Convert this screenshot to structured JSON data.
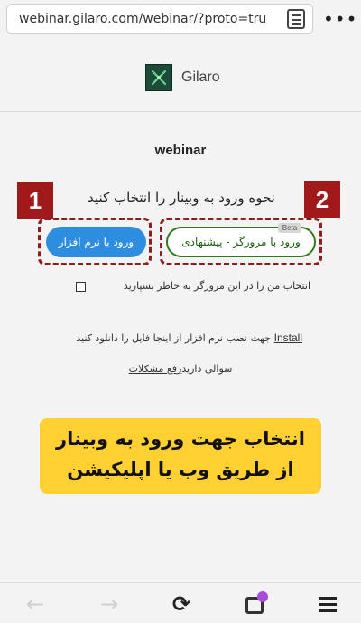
{
  "browser": {
    "url": "webinar.gilaro.com/webinar/?proto=tru",
    "reader_icon": "reader-mode-icon",
    "menu_icon": "more-dots-icon",
    "menu_glyph": "•••"
  },
  "header": {
    "logo_icon": "gilaro-logo-icon",
    "brand": "Gilaro"
  },
  "page": {
    "title": "webinar",
    "question": "نحوه ورود به وبینار را انتخاب کنید",
    "badge_1": "1",
    "badge_2": "2",
    "app_button": "ورود با نرم افزار",
    "browser_button": "ورود با مرورگر - پیشنهادی",
    "beta_badge": "Beta",
    "remember_label": "انتخاب من را در این مرورگر به خاطر بسپارید",
    "install_link": "Install",
    "install_text": " جهت نصب نرم افزار از اینجا فایل را دانلود کنید",
    "support_prefix": "سوالی دارید",
    "support_link": "رفع مشکلات",
    "callout": "انتخاب جهت ورود به وبینار از طریق وب یا اپلیکیشن"
  },
  "toolbar": {
    "back_glyph": "←",
    "forward_glyph": "→",
    "reload_glyph": "⟳",
    "back_icon": "back-arrow-icon",
    "forward_icon": "forward-arrow-icon",
    "reload_icon": "reload-icon",
    "tabs_icon": "tabs-icon",
    "menu_icon": "hamburger-menu-icon"
  },
  "colors": {
    "badge_red": "#a01a1a",
    "app_button_blue": "#2d8ee0",
    "browser_button_green": "#2f7a1a",
    "callout_yellow": "#ffd032",
    "tabs_dot_purple": "#a64dd8"
  }
}
